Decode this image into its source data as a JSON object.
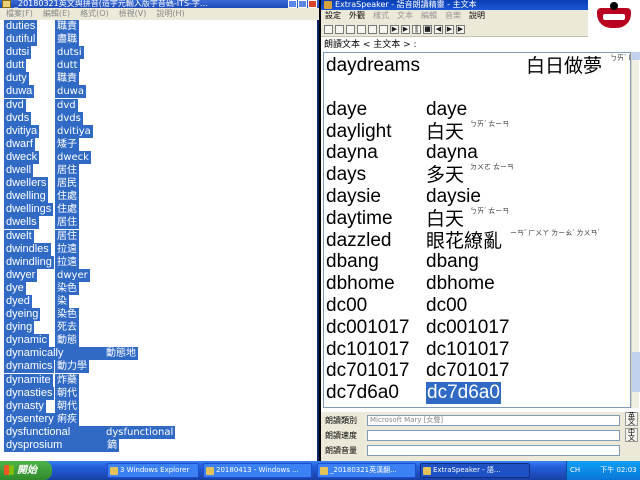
{
  "left_window": {
    "title": "_20180321英文與拼音(造字元輸入版字音碼-ITS-字...",
    "menu": [
      "檔案(F)",
      "編輯(E)",
      "格式(O)",
      "檢視(V)",
      "說明(H)"
    ],
    "rows": [
      {
        "en": "duties",
        "zh": "職責"
      },
      {
        "en": "dutiful",
        "zh": "盡職"
      },
      {
        "en": "dutsi",
        "zh": "dutsi"
      },
      {
        "en": "dutt",
        "zh": "dutt"
      },
      {
        "en": "duty",
        "zh": "職責"
      },
      {
        "en": "duwa",
        "zh": "duwa"
      },
      {
        "en": "dvd",
        "zh": "dvd"
      },
      {
        "en": "dvds",
        "zh": "dvds"
      },
      {
        "en": "dvitiya",
        "zh": "dvitiya"
      },
      {
        "en": "dwarf",
        "zh": "矮子"
      },
      {
        "en": "dweck",
        "zh": "dweck"
      },
      {
        "en": "dwell",
        "zh": "居住"
      },
      {
        "en": "dwellers",
        "zh": "居民"
      },
      {
        "en": "dwelling",
        "zh": "住處"
      },
      {
        "en": "dwellings",
        "zh": "住處"
      },
      {
        "en": "dwells",
        "zh": "居住"
      },
      {
        "en": "dwelt",
        "zh": "居住"
      },
      {
        "en": "dwindles",
        "zh": "拉遠"
      },
      {
        "en": "dwindling",
        "zh": "拉遠"
      },
      {
        "en": "dwyer",
        "zh": "dwyer"
      },
      {
        "en": "dye",
        "zh": "染色"
      },
      {
        "en": "dyed",
        "zh": "染"
      },
      {
        "en": "dyeing",
        "zh": "染色"
      },
      {
        "en": "dying",
        "zh": "死去"
      },
      {
        "en": "dynamic",
        "zh": "動態"
      },
      {
        "en": "dynamically",
        "zh": "動態地"
      },
      {
        "en": "dynamics",
        "zh": "動力學"
      },
      {
        "en": "dynamite",
        "zh": "炸藥"
      },
      {
        "en": "dynasties",
        "zh": "朝代"
      },
      {
        "en": "dynasty",
        "zh": "朝代"
      },
      {
        "en": "dysentery",
        "zh": "痢疾"
      },
      {
        "en": "dysfunctional",
        "zh": "dysfunctional"
      },
      {
        "en": "dysprosium",
        "zh": "鏑"
      }
    ]
  },
  "right_window": {
    "title": "ExtraSpeaker - 語音朗讀精靈 - 主文本",
    "menu": [
      {
        "label": "設定",
        "disabled": false
      },
      {
        "label": "外觀",
        "disabled": false
      },
      {
        "label": "樣式",
        "disabled": true
      },
      {
        "label": "文本",
        "disabled": true
      },
      {
        "label": "編輯",
        "disabled": true
      },
      {
        "label": "音樂",
        "disabled": true
      },
      {
        "label": "說明",
        "disabled": false
      }
    ],
    "reading_label": "朗讀文本 < 主文本 > :",
    "rows": [
      {
        "en": "daydreams",
        "zh": "白日做夢",
        "zy": "ㄅㄞˊ ㄖˋ ㄗㄨㄛˋ ㄇㄥˋ",
        "type": "zh"
      },
      {
        "en": "daye",
        "zh": "daye",
        "type": "en"
      },
      {
        "en": "daylight",
        "zh": "白天",
        "zy": "ㄅㄞˊ ㄊㄧㄢ",
        "type": "zh"
      },
      {
        "en": "dayna",
        "zh": "dayna",
        "type": "en"
      },
      {
        "en": "days",
        "zh": "多天",
        "zy": "ㄉㄨㄛ ㄊㄧㄢ",
        "type": "zh"
      },
      {
        "en": "daysie",
        "zh": "daysie",
        "type": "en"
      },
      {
        "en": "daytime",
        "zh": "白天",
        "zy": "ㄅㄞˊ ㄊㄧㄢ",
        "type": "zh"
      },
      {
        "en": "dazzled",
        "zh": "眼花繚亂",
        "zy": "ㄧㄢˇ ㄏㄨㄚ ㄌㄧㄠˊ ㄌㄨㄢˋ",
        "type": "zh"
      },
      {
        "en": "dbang",
        "zh": "dbang",
        "type": "en"
      },
      {
        "en": "dbhome",
        "zh": "dbhome",
        "type": "en"
      },
      {
        "en": "dc00",
        "zh": "dc00",
        "type": "en"
      },
      {
        "en": "dc001017",
        "zh": "dc001017",
        "type": "en"
      },
      {
        "en": "dc101017",
        "zh": "dc101017",
        "type": "en"
      },
      {
        "en": "dc701017",
        "zh": "dc701017",
        "type": "en"
      },
      {
        "en": "dc7d6a0",
        "zh": "dc7d6a0",
        "type": "sel"
      }
    ],
    "bottom": {
      "voice_label": "朗讀類別",
      "voice_value": "Microsoft Mary [女聲]",
      "speed_label": "朗讀速度",
      "volume_label": "朗讀音量"
    },
    "side_buttons": [
      "英文",
      "中文"
    ]
  },
  "taskbar": {
    "start_label": "開始",
    "tasks": [
      {
        "label": "3 Windows Explorer"
      },
      {
        "label": "20180413 - Windows ..."
      },
      {
        "label": "_20180321英漢翻..."
      },
      {
        "label": "ExtraSpeaker - 語..."
      }
    ],
    "tray_lang": "CH",
    "clock": "下午 02:03"
  }
}
